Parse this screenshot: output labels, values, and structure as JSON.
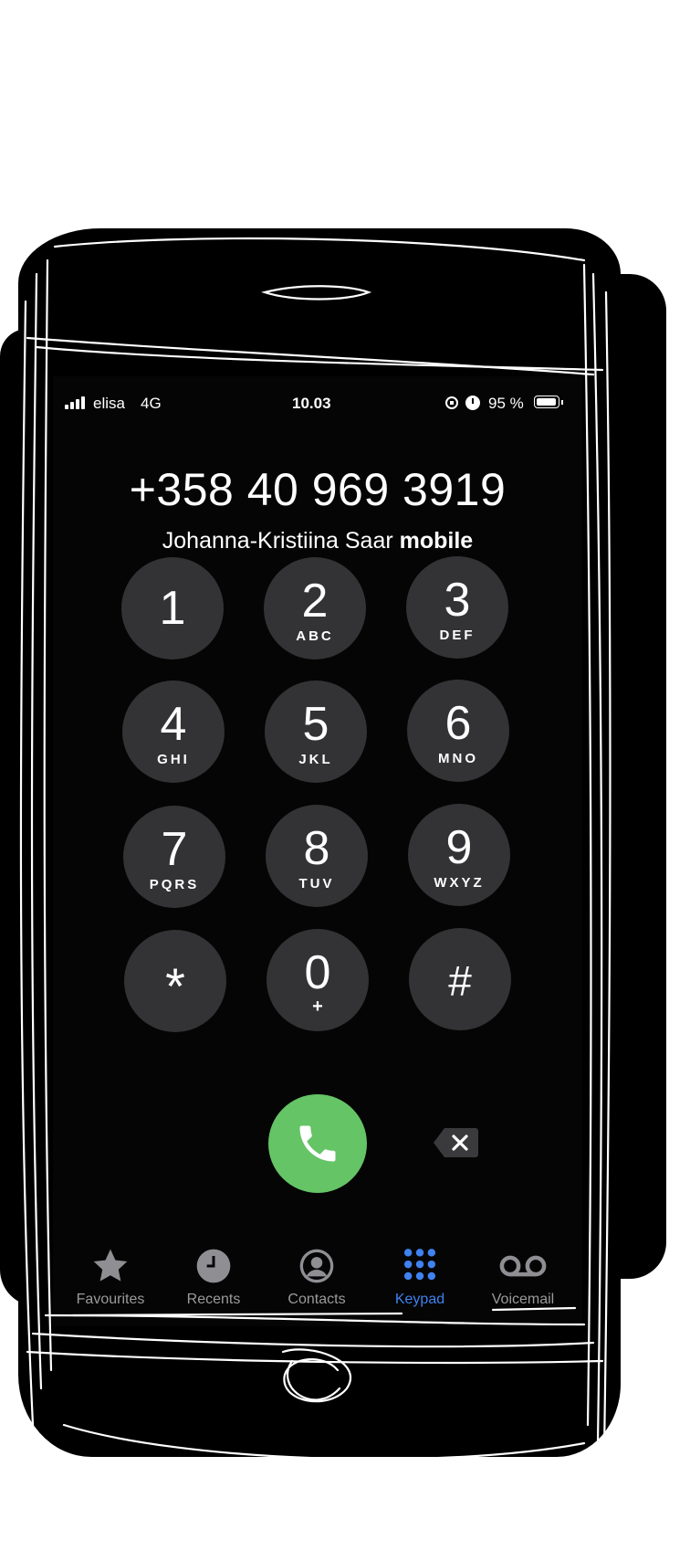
{
  "status_bar": {
    "carrier": "elisa",
    "network": "4G",
    "time": "10.03",
    "battery": "95 %",
    "icons": [
      "signal-icon",
      "orientation-lock-icon",
      "alarm-icon",
      "battery-icon"
    ]
  },
  "dialer": {
    "number": "+358 40 969 3919",
    "contact_name": "Johanna-Kristiina Saar",
    "contact_label": "mobile"
  },
  "keypad": {
    "keys": [
      {
        "digit": "1",
        "letters": ""
      },
      {
        "digit": "2",
        "letters": "ABC"
      },
      {
        "digit": "3",
        "letters": "DEF"
      },
      {
        "digit": "4",
        "letters": "GHI"
      },
      {
        "digit": "5",
        "letters": "JKL"
      },
      {
        "digit": "6",
        "letters": "MNO"
      },
      {
        "digit": "7",
        "letters": "PQRS"
      },
      {
        "digit": "8",
        "letters": "TUV"
      },
      {
        "digit": "9",
        "letters": "WXYZ"
      },
      {
        "digit": "*",
        "letters": ""
      },
      {
        "digit": "0",
        "letters": "+"
      },
      {
        "digit": "#",
        "letters": ""
      }
    ],
    "call_icon": "phone-icon",
    "delete_icon": "delete-icon"
  },
  "tab_bar": {
    "active": "Keypad",
    "tabs": [
      {
        "label": "Favourites",
        "icon": "star-icon"
      },
      {
        "label": "Recents",
        "icon": "clock-icon"
      },
      {
        "label": "Contacts",
        "icon": "person-circle-icon"
      },
      {
        "label": "Keypad",
        "icon": "keypad-icon"
      },
      {
        "label": "Voicemail",
        "icon": "voicemail-icon"
      }
    ]
  },
  "colors": {
    "background": "#050505",
    "key": "#333335",
    "call_green": "#65c466",
    "active_tab": "#3f82f0",
    "inactive_tab": "#9a9a9a"
  }
}
